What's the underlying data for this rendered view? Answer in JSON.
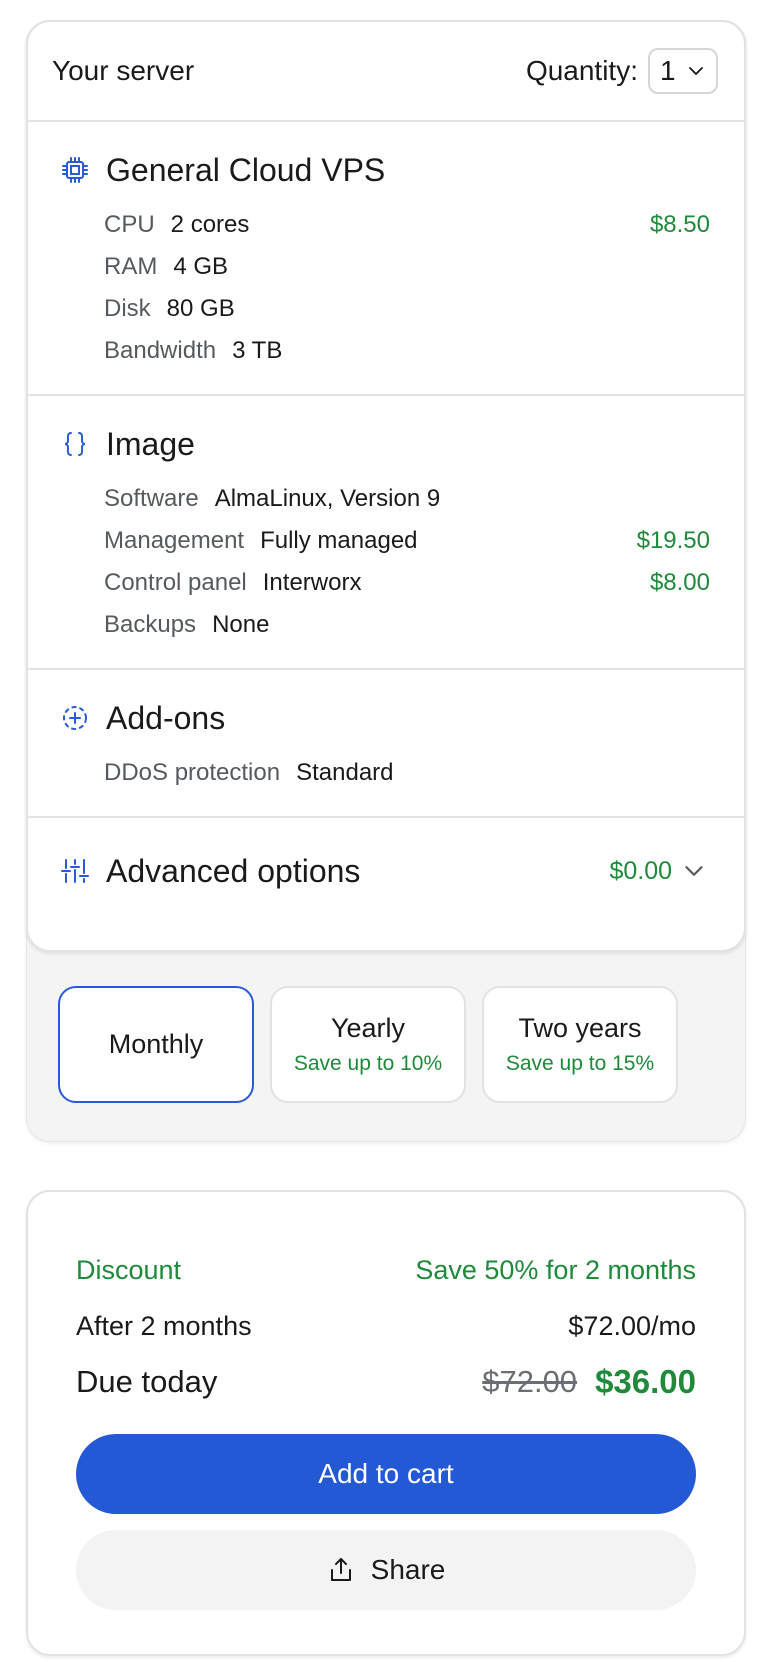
{
  "server": {
    "title": "Your server",
    "quantity_label": "Quantity:",
    "quantity_value": "1"
  },
  "sections": {
    "vps": {
      "icon": "cpu-icon",
      "title": "General Cloud VPS",
      "rows": [
        {
          "key": "CPU",
          "value": "2 cores",
          "price": "$8.50"
        },
        {
          "key": "RAM",
          "value": "4 GB",
          "price": ""
        },
        {
          "key": "Disk",
          "value": "80 GB",
          "price": ""
        },
        {
          "key": "Bandwidth",
          "value": "3 TB",
          "price": ""
        }
      ]
    },
    "image": {
      "icon": "braces-icon",
      "title": "Image",
      "rows": [
        {
          "key": "Software",
          "value": "AlmaLinux, Version 9",
          "price": ""
        },
        {
          "key": "Management",
          "value": "Fully managed",
          "price": "$19.50"
        },
        {
          "key": "Control panel",
          "value": "Interworx",
          "price": "$8.00"
        },
        {
          "key": "Backups",
          "value": "None",
          "price": ""
        }
      ]
    },
    "addons": {
      "icon": "plus-circle-icon",
      "title": "Add-ons",
      "rows": [
        {
          "key": "DDoS protection",
          "value": "Standard",
          "price": ""
        }
      ]
    },
    "advanced": {
      "icon": "sliders-icon",
      "title": "Advanced options",
      "price": "$0.00"
    }
  },
  "billing": [
    {
      "label": "Monthly",
      "save": "",
      "active": true
    },
    {
      "label": "Yearly",
      "save": "Save up to 10%",
      "active": false
    },
    {
      "label": "Two years",
      "save": "Save up to 15%",
      "active": false
    }
  ],
  "summary": {
    "discount_label": "Discount",
    "discount_value": "Save 50% for 2 months",
    "after_label": "After 2 months",
    "after_value": "$72.00/mo",
    "due_label": "Due today",
    "due_old": "$72.00",
    "due_new": "$36.00",
    "cart_label": "Add to cart",
    "share_label": "Share"
  },
  "colors": {
    "accent_blue": "#2459d6",
    "price_green": "#1e8a3a",
    "icon_blue": "#2a5bd7"
  }
}
